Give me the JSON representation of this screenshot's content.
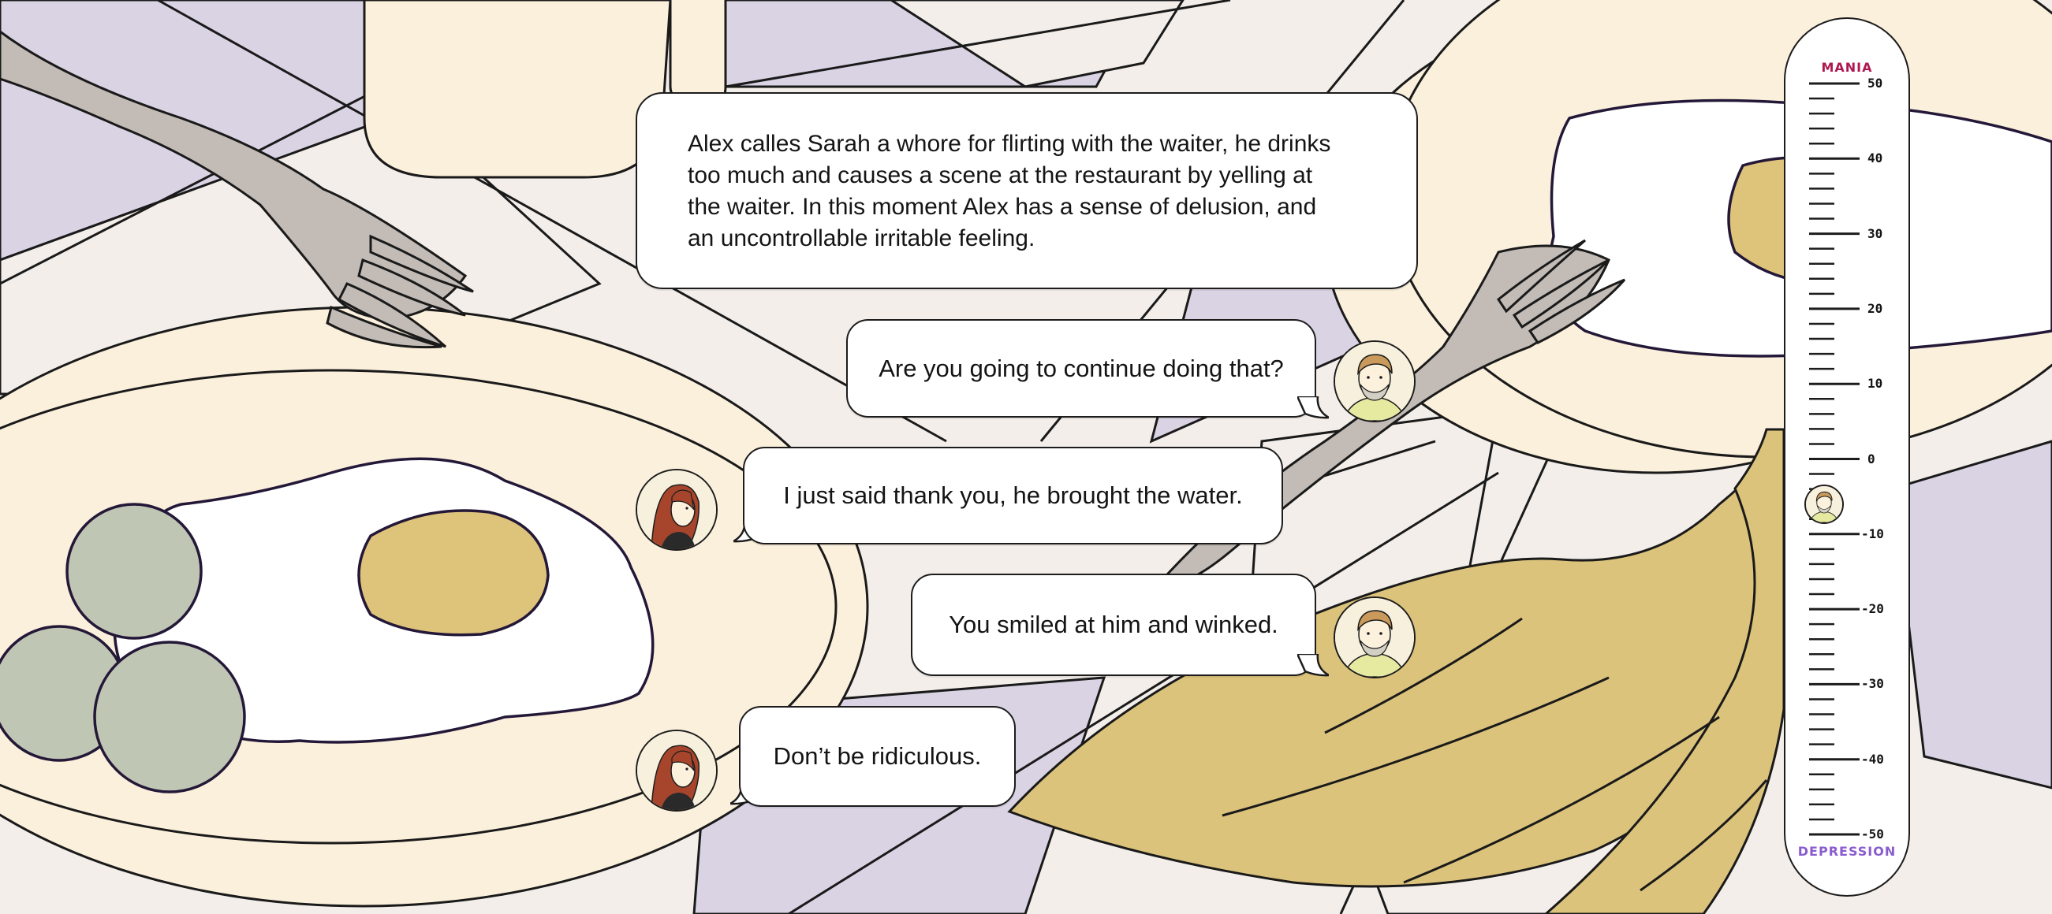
{
  "narration": {
    "lines": [
      "Alex calles Sarah a whore for flirting with the waiter, he drinks",
      "too much and causes a scene at the restaurant by yelling at",
      "the waiter. In this moment Alex has a sense of delusion, and",
      "an uncontrollable irritable feeling."
    ]
  },
  "dialogue": [
    {
      "speaker": "alex",
      "text": "Are you going to continue doing that?"
    },
    {
      "speaker": "sarah",
      "text": "I just said thank you, he brought the water."
    },
    {
      "speaker": "alex",
      "text": "You smiled at him and winked."
    },
    {
      "speaker": "sarah",
      "text": "Don’t be ridiculous."
    }
  ],
  "mood_meter": {
    "top_label": "MANIA",
    "bottom_label": "DEPRESSION",
    "tick_labels": [
      "50",
      "40",
      "30",
      "20",
      "10",
      "0",
      "-10",
      "-20",
      "-30",
      "-40",
      "-50"
    ],
    "current_value": -6,
    "top_color": "#b0174f",
    "bottom_color": "#8a5ccf"
  },
  "colors": {
    "cream": "#fbf0dc",
    "lavender": "#d9d3e4",
    "gray_white": "#f3eeea",
    "egg_yolk": "#dec37b",
    "banana": "#dcc37c",
    "fork": "#c2bbb6",
    "peas": "#c0c6b4"
  }
}
